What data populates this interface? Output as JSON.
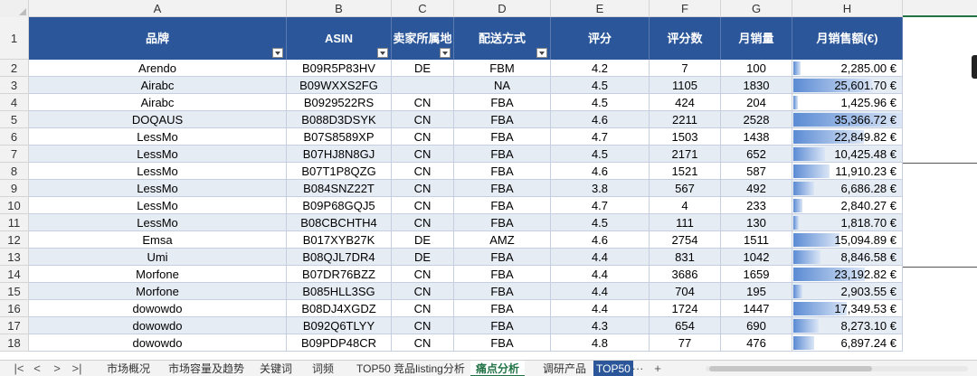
{
  "columns": [
    "A",
    "B",
    "C",
    "D",
    "E",
    "F",
    "G",
    "H"
  ],
  "header": {
    "row_number": "1",
    "labels": [
      "品牌",
      "ASIN",
      "卖家所属地",
      "配送方式",
      "评分",
      "评分数",
      "月销量",
      "月销售额(€)"
    ],
    "filter_cols": [
      0,
      1,
      2,
      3
    ]
  },
  "rows": [
    {
      "n": "2",
      "brand": "Arendo",
      "asin": "B09R5P83HV",
      "origin": "DE",
      "ship": "FBM",
      "rating": "4.2",
      "reviews": "7",
      "sales": "100",
      "revenue": "2,285.00 €",
      "rev_value": 2285.0
    },
    {
      "n": "3",
      "brand": "Airabc",
      "asin": "B09WXXS2FG",
      "origin": "",
      "ship": "NA",
      "rating": "4.5",
      "reviews": "1105",
      "sales": "1830",
      "revenue": "25,601.70 €",
      "rev_value": 25601.7
    },
    {
      "n": "4",
      "brand": "Airabc",
      "asin": "B0929522RS",
      "origin": "CN",
      "ship": "FBA",
      "rating": "4.5",
      "reviews": "424",
      "sales": "204",
      "revenue": "1,425.96 €",
      "rev_value": 1425.96
    },
    {
      "n": "5",
      "brand": "DOQAUS",
      "asin": "B088D3DSYK",
      "origin": "CN",
      "ship": "FBA",
      "rating": "4.6",
      "reviews": "2211",
      "sales": "2528",
      "revenue": "35,366.72 €",
      "rev_value": 35366.72
    },
    {
      "n": "6",
      "brand": "LessMo",
      "asin": "B07S8589XP",
      "origin": "CN",
      "ship": "FBA",
      "rating": "4.7",
      "reviews": "1503",
      "sales": "1438",
      "revenue": "22,849.82 €",
      "rev_value": 22849.82
    },
    {
      "n": "7",
      "brand": "LessMo",
      "asin": "B07HJ8N8GJ",
      "origin": "CN",
      "ship": "FBA",
      "rating": "4.5",
      "reviews": "2171",
      "sales": "652",
      "revenue": "10,425.48 €",
      "rev_value": 10425.48
    },
    {
      "n": "8",
      "brand": "LessMo",
      "asin": "B07T1P8QZG",
      "origin": "CN",
      "ship": "FBA",
      "rating": "4.6",
      "reviews": "1521",
      "sales": "587",
      "revenue": "11,910.23 €",
      "rev_value": 11910.23
    },
    {
      "n": "9",
      "brand": "LessMo",
      "asin": "B084SNZ22T",
      "origin": "CN",
      "ship": "FBA",
      "rating": "3.8",
      "reviews": "567",
      "sales": "492",
      "revenue": "6,686.28 €",
      "rev_value": 6686.28
    },
    {
      "n": "10",
      "brand": "LessMo",
      "asin": "B09P68GQJ5",
      "origin": "CN",
      "ship": "FBA",
      "rating": "4.7",
      "reviews": "4",
      "sales": "233",
      "revenue": "2,840.27 €",
      "rev_value": 2840.27
    },
    {
      "n": "11",
      "brand": "LessMo",
      "asin": "B08CBCHTH4",
      "origin": "CN",
      "ship": "FBA",
      "rating": "4.5",
      "reviews": "111",
      "sales": "130",
      "revenue": "1,818.70 €",
      "rev_value": 1818.7
    },
    {
      "n": "12",
      "brand": "Emsa",
      "asin": "B017XYB27K",
      "origin": "DE",
      "ship": "AMZ",
      "rating": "4.6",
      "reviews": "2754",
      "sales": "1511",
      "revenue": "15,094.89 €",
      "rev_value": 15094.89
    },
    {
      "n": "13",
      "brand": "Umi",
      "asin": "B08QJL7DR4",
      "origin": "DE",
      "ship": "FBA",
      "rating": "4.4",
      "reviews": "831",
      "sales": "1042",
      "revenue": "8,846.58 €",
      "rev_value": 8846.58
    },
    {
      "n": "14",
      "brand": "Morfone",
      "asin": "B07DR76BZZ",
      "origin": "CN",
      "ship": "FBA",
      "rating": "4.4",
      "reviews": "3686",
      "sales": "1659",
      "revenue": "23,192.82 €",
      "rev_value": 23192.82
    },
    {
      "n": "15",
      "brand": "Morfone",
      "asin": "B085HLL3SG",
      "origin": "CN",
      "ship": "FBA",
      "rating": "4.4",
      "reviews": "704",
      "sales": "195",
      "revenue": "2,903.55 €",
      "rev_value": 2903.55
    },
    {
      "n": "16",
      "brand": "dowowdo",
      "asin": "B08DJ4XGDZ",
      "origin": "CN",
      "ship": "FBA",
      "rating": "4.4",
      "reviews": "1724",
      "sales": "1447",
      "revenue": "17,349.53 €",
      "rev_value": 17349.53
    },
    {
      "n": "17",
      "brand": "dowowdo",
      "asin": "B092Q6TLYY",
      "origin": "CN",
      "ship": "FBA",
      "rating": "4.3",
      "reviews": "654",
      "sales": "690",
      "revenue": "8,273.10 €",
      "rev_value": 8273.1
    },
    {
      "n": "18",
      "brand": "dowowdo",
      "asin": "B09PDP48CR",
      "origin": "CN",
      "ship": "FBA",
      "rating": "4.8",
      "reviews": "77",
      "sales": "476",
      "revenue": "6,897.24 €",
      "rev_value": 6897.24
    }
  ],
  "data_bar_max": 35366.72,
  "sheet_tabs": [
    "市场概况",
    "市场容量及趋势",
    "关键词",
    "词频",
    "TOP50 竞品listing分析",
    "痛点分析",
    "调研产品",
    "TOP50"
  ],
  "active_tab": "痛点分析",
  "nav_buttons": [
    "|<",
    "<",
    ">",
    ">|"
  ],
  "more_tabs": "···",
  "add_sheet": "+",
  "colors": {
    "header_fill": "#2b579a",
    "band_fill": "#e6ecf4",
    "accent": "#217346",
    "data_bar": "#5b8bd4"
  }
}
